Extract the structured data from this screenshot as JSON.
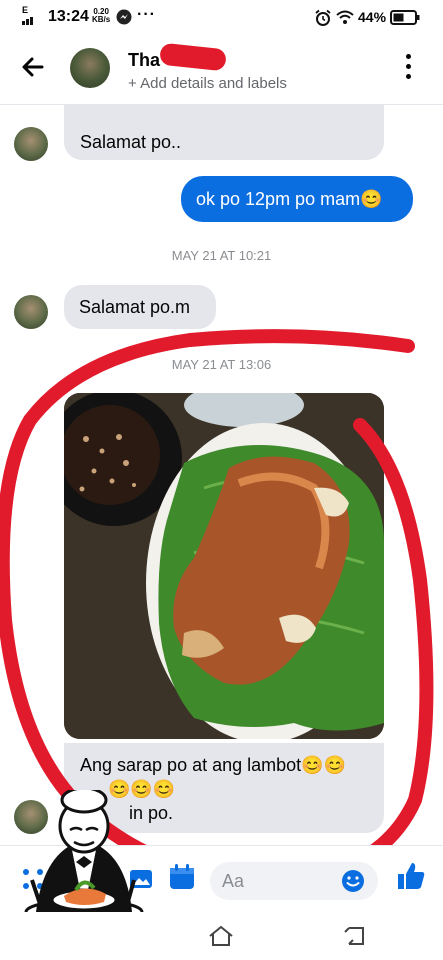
{
  "status_bar": {
    "network": "E",
    "time": "13:24",
    "speed_value": "0.20",
    "speed_unit": "KB/s",
    "more": "···",
    "battery": "44%"
  },
  "header": {
    "contact_name": "Tha",
    "subtitle": "+ Add details and labels"
  },
  "messages": [
    {
      "from": "them",
      "text": "Salamat po.."
    },
    {
      "from": "me",
      "text": "ok po 12pm po mam😊"
    },
    {
      "timestamp": "MAY 21 AT 10:21"
    },
    {
      "from": "them",
      "text": "Salamat po.m"
    },
    {
      "timestamp": "MAY 21 AT 13:06"
    },
    {
      "from": "them",
      "type": "photo"
    },
    {
      "from": "them",
      "text_line1": "Ang sarap po at ang lambot😊😊",
      "text_line2": "😊😊😊",
      "text_line3": "in po."
    }
  ],
  "composer": {
    "placeholder": "Aa"
  },
  "colors": {
    "accent": "#0a6de0",
    "annotation_red": "#e21b2c",
    "bubble_in": "#e4e6eb"
  }
}
